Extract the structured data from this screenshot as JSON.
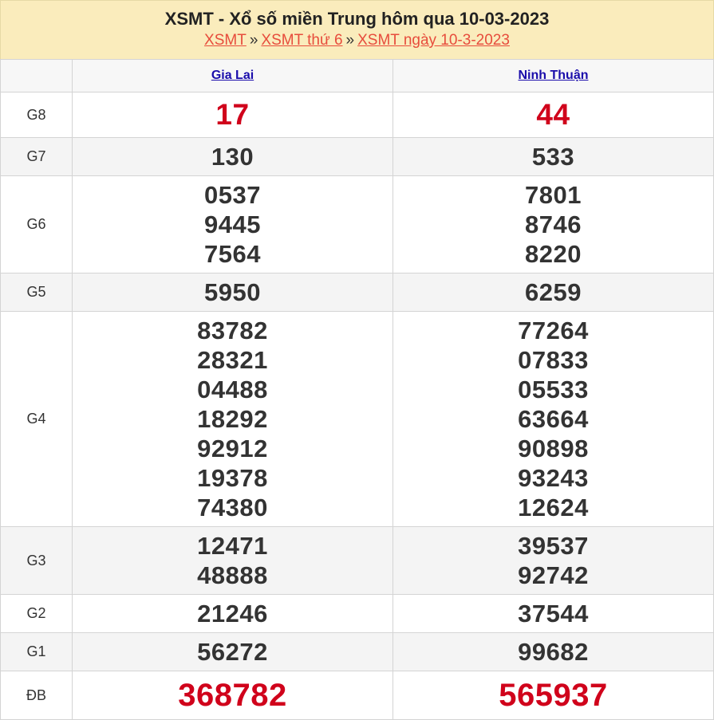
{
  "header": {
    "title": "XSMT - Xổ số miền Trung hôm qua 10-03-2023",
    "breadcrumbs": [
      "XSMT",
      "XSMT thứ 6",
      "XSMT ngày 10-3-2023"
    ],
    "separator": "»"
  },
  "columns": [
    "Gia Lai",
    "Ninh Thuận"
  ],
  "prizes": [
    {
      "label": "G8",
      "gia_lai": [
        "17"
      ],
      "ninh_thuan": [
        "44"
      ]
    },
    {
      "label": "G7",
      "gia_lai": [
        "130"
      ],
      "ninh_thuan": [
        "533"
      ]
    },
    {
      "label": "G6",
      "gia_lai": [
        "0537",
        "9445",
        "7564"
      ],
      "ninh_thuan": [
        "7801",
        "8746",
        "8220"
      ]
    },
    {
      "label": "G5",
      "gia_lai": [
        "5950"
      ],
      "ninh_thuan": [
        "6259"
      ]
    },
    {
      "label": "G4",
      "gia_lai": [
        "83782",
        "28321",
        "04488",
        "18292",
        "92912",
        "19378",
        "74380"
      ],
      "ninh_thuan": [
        "77264",
        "07833",
        "05533",
        "63664",
        "90898",
        "93243",
        "12624"
      ]
    },
    {
      "label": "G3",
      "gia_lai": [
        "12471",
        "48888"
      ],
      "ninh_thuan": [
        "39537",
        "92742"
      ]
    },
    {
      "label": "G2",
      "gia_lai": [
        "21246"
      ],
      "ninh_thuan": [
        "37544"
      ]
    },
    {
      "label": "G1",
      "gia_lai": [
        "56272"
      ],
      "ninh_thuan": [
        "99682"
      ]
    },
    {
      "label": "ĐB",
      "gia_lai": [
        "368782"
      ],
      "ninh_thuan": [
        "565937"
      ]
    }
  ],
  "colors": {
    "accent_red": "#d0021b",
    "link_blue": "#1a0dab",
    "header_bg": "#faecbc",
    "breadcrumb_link": "#e74c3c"
  }
}
